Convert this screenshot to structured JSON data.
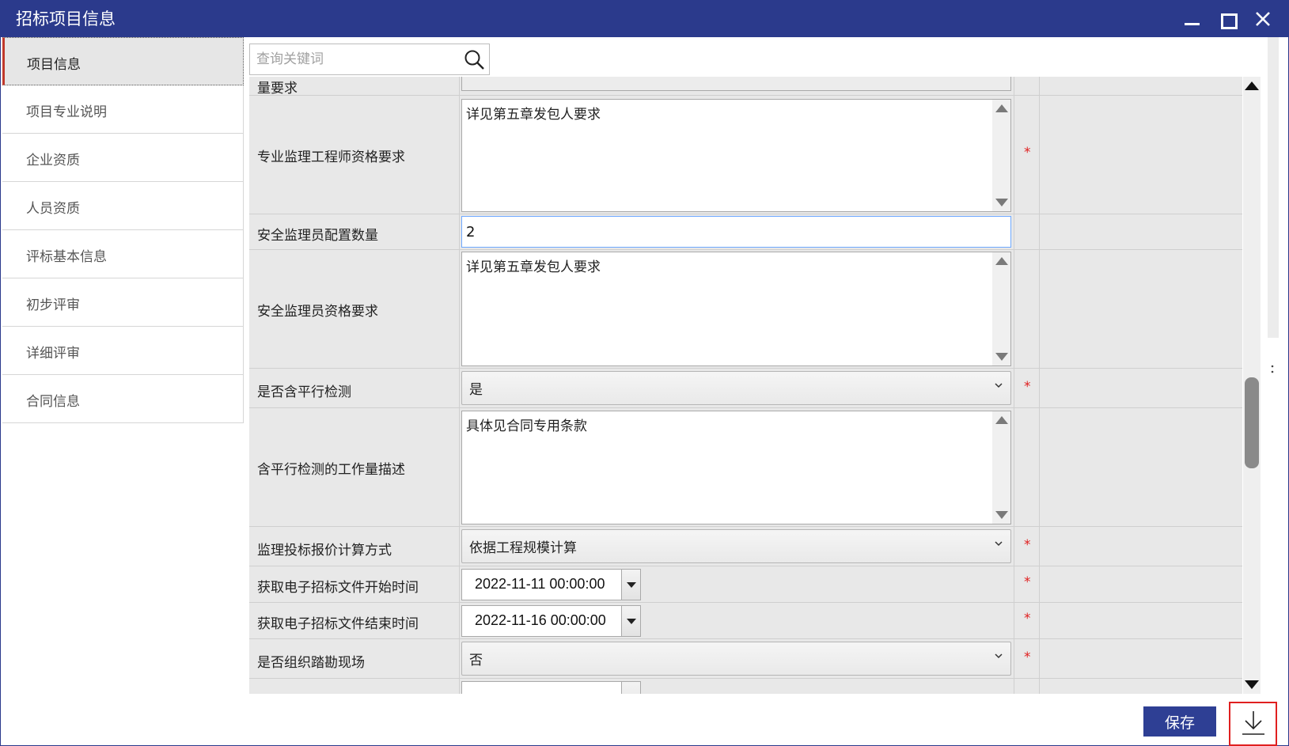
{
  "window": {
    "title": "招标项目信息"
  },
  "sidebar": {
    "items": [
      {
        "label": "项目信息",
        "active": true
      },
      {
        "label": "项目专业说明"
      },
      {
        "label": "企业资质"
      },
      {
        "label": "人员资质"
      },
      {
        "label": "评标基本信息"
      },
      {
        "label": "初步评审"
      },
      {
        "label": "详细评审"
      },
      {
        "label": "合同信息"
      }
    ]
  },
  "search": {
    "placeholder": "查询关键词",
    "icon": "search-icon"
  },
  "form": {
    "partial_top_label": "量要求",
    "rows": [
      {
        "label": "专业监理工程师资格要求",
        "type": "textarea",
        "value": "详见第五章发包人要求",
        "required": true
      },
      {
        "label": "安全监理员配置数量",
        "type": "text",
        "value": "2",
        "required": false
      },
      {
        "label": "安全监理员资格要求",
        "type": "textarea",
        "value": "详见第五章发包人要求",
        "required": false
      },
      {
        "label": "是否含平行检测",
        "type": "select",
        "value": "是",
        "required": true
      },
      {
        "label": "含平行检测的工作量描述",
        "type": "textarea",
        "value": "具体见合同专用条款",
        "required": false
      },
      {
        "label": "监理投标报价计算方式",
        "type": "select",
        "value": "依据工程规模计算",
        "required": true
      },
      {
        "label": "获取电子招标文件开始时间",
        "type": "datetime",
        "value": "2022-11-11 00:00:00",
        "required": true
      },
      {
        "label": "获取电子招标文件结束时间",
        "type": "datetime",
        "value": "2022-11-16 00:00:00",
        "required": true
      },
      {
        "label": "是否组织踏勘现场",
        "type": "select",
        "value": "否",
        "required": true
      }
    ],
    "required_mark": "*"
  },
  "footer": {
    "save_label": "保存",
    "download_icon": "download-icon"
  },
  "colors": {
    "titlebar": "#2b3a8c",
    "save_button": "#2e3f94",
    "required": "#e02020",
    "highlight_box": "#e02020"
  }
}
